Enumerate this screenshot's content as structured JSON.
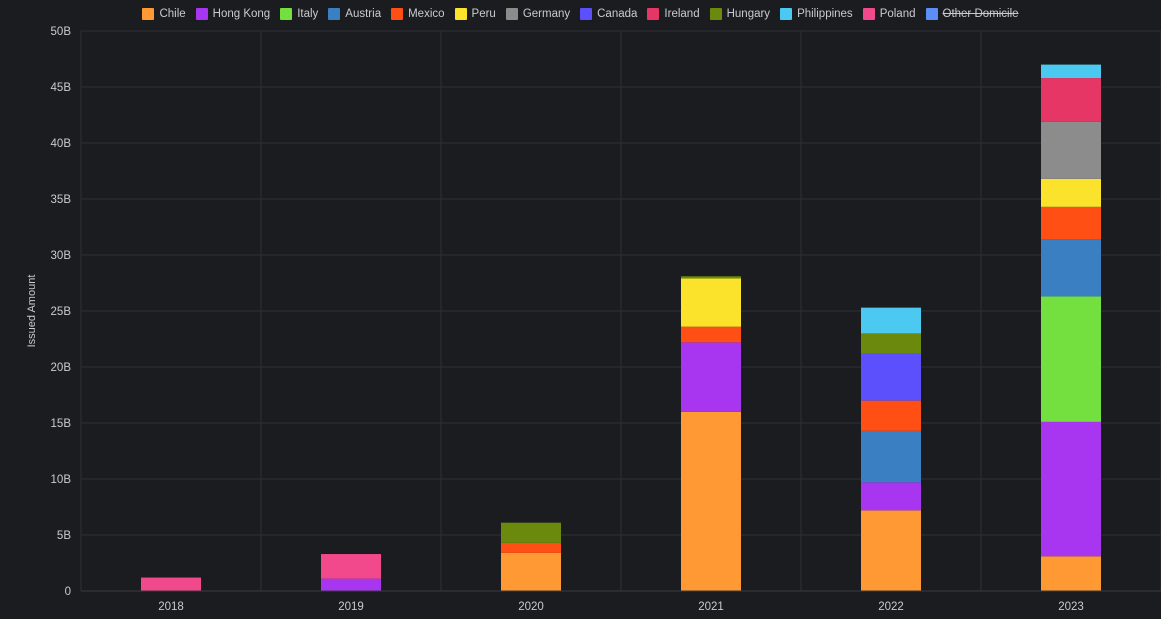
{
  "chart_data": {
    "type": "bar",
    "stacked": true,
    "ylabel": "Issued Amount",
    "ylim": [
      0,
      50
    ],
    "y_unit": "B",
    "y_ticks": [
      "0",
      "5B",
      "10B",
      "15B",
      "20B",
      "25B",
      "30B",
      "35B",
      "40B",
      "45B",
      "50B"
    ],
    "grid": true,
    "legend_position": "top-center",
    "categories": [
      "2018",
      "2019",
      "2020",
      "2021",
      "2022",
      "2023"
    ],
    "series": [
      {
        "name": "Chile",
        "color": "#ff9933",
        "values": [
          0,
          0,
          3.4,
          16.0,
          7.2,
          3.1
        ]
      },
      {
        "name": "Hong Kong",
        "color": "#a835f0",
        "values": [
          0,
          1.1,
          0,
          6.2,
          2.5,
          12.0
        ]
      },
      {
        "name": "Italy",
        "color": "#73e03f",
        "values": [
          0,
          0,
          0,
          0,
          0,
          11.2
        ]
      },
      {
        "name": "Austria",
        "color": "#3a7fc1",
        "values": [
          0,
          0,
          0,
          0,
          4.6,
          5.1
        ]
      },
      {
        "name": "Mexico",
        "color": "#ff4f14",
        "values": [
          0,
          0,
          0.9,
          1.4,
          2.7,
          2.9
        ]
      },
      {
        "name": "Peru",
        "color": "#fbe32b",
        "values": [
          0,
          0,
          0,
          4.3,
          0,
          2.5
        ]
      },
      {
        "name": "Germany",
        "color": "#8c8c8c",
        "values": [
          0,
          0,
          0,
          0,
          0,
          5.1
        ]
      },
      {
        "name": "Canada",
        "color": "#5b50fb",
        "values": [
          0,
          0,
          0,
          0,
          4.2,
          0
        ]
      },
      {
        "name": "Ireland",
        "color": "#e53666",
        "values": [
          0,
          0,
          0,
          0,
          0,
          3.9
        ]
      },
      {
        "name": "Hungary",
        "color": "#6b8a0d",
        "values": [
          0,
          0,
          1.8,
          0.2,
          1.8,
          0
        ]
      },
      {
        "name": "Philippines",
        "color": "#4bc9f0",
        "values": [
          0,
          0,
          0,
          0,
          2.3,
          1.2
        ]
      },
      {
        "name": "Poland",
        "color": "#f2498c",
        "values": [
          1.2,
          2.2,
          0,
          0,
          0,
          0
        ]
      },
      {
        "name": "Other Domicile",
        "color": "#5b8ff5",
        "hidden": true,
        "values": [
          0,
          0,
          0,
          0,
          0,
          0
        ]
      }
    ]
  }
}
